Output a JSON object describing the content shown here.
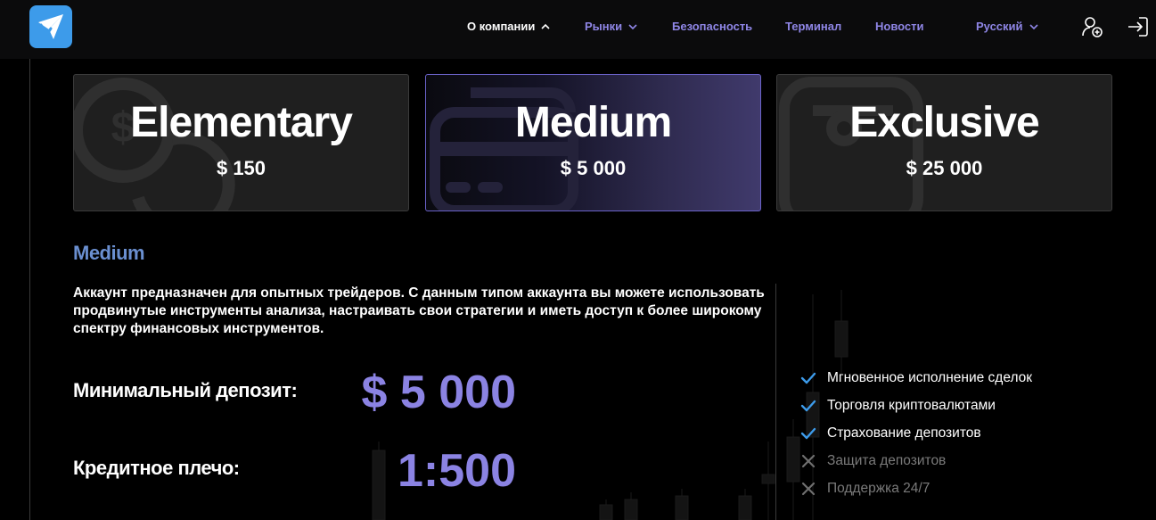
{
  "header": {
    "logo_icon": "paper-plane-check-icon",
    "nav": [
      {
        "label": "О компании",
        "dropdown": true,
        "active": true
      },
      {
        "label": "Рынки",
        "dropdown": true,
        "active": false
      },
      {
        "label": "Безопасность",
        "dropdown": false,
        "active": false
      },
      {
        "label": "Терминал",
        "dropdown": false,
        "active": false
      },
      {
        "label": "Новости",
        "dropdown": false,
        "active": false
      }
    ],
    "language": "Русский",
    "register_icon": "user-add-icon",
    "login_icon": "login-icon"
  },
  "plans": [
    {
      "name": "Elementary",
      "price": "$ 150",
      "icon": "coins-icon",
      "selected": false
    },
    {
      "name": "Medium",
      "price": "$ 5 000",
      "icon": "credit-card-icon",
      "selected": true
    },
    {
      "name": "Exclusive",
      "price": "$ 25 000",
      "icon": "wallet-icon",
      "selected": false
    }
  ],
  "details": {
    "title": "Medium",
    "description": "Аккаунт предназначен для опытных трейдеров. С данным типом аккаунта вы можете использовать продвинутые инструменты анализа, настраивать свои стратегии и иметь доступ к более широкому спектру финансовых инструментов.",
    "min_deposit_label": "Минимальный депозит:",
    "min_deposit_value": "$ 5 000",
    "leverage_label": "Кредитное плечо:",
    "leverage_value": "1:500"
  },
  "features": [
    {
      "label": "Мгновенное исполнение сделок",
      "included": true
    },
    {
      "label": "Торговля криптовалютами",
      "included": true
    },
    {
      "label": "Страхование депозитов",
      "included": true
    },
    {
      "label": "Защита депозитов",
      "included": false
    },
    {
      "label": "Поддержка 24/7",
      "included": false
    }
  ],
  "colors": {
    "accent": "#8b83e3",
    "title": "#6a8fd0",
    "check": "#3d9bea",
    "logo": "#3d9bea"
  }
}
